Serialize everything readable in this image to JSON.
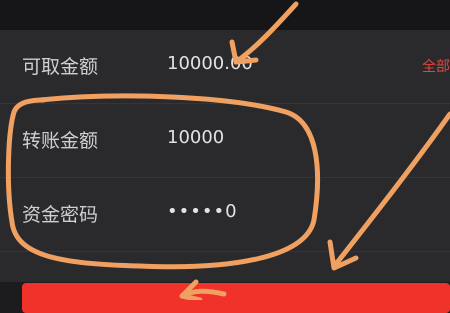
{
  "form": {
    "available_amount": {
      "label": "可取金额",
      "value": "10000.00",
      "action_label": "全部"
    },
    "transfer_amount": {
      "label": "转账金额",
      "value": "10000"
    },
    "fund_password": {
      "label": "资金密码",
      "masked_value": "•••••0"
    }
  },
  "colors": {
    "background": "#1c1c1e",
    "panel": "#2a2a2d",
    "accent_red": "#f0322b",
    "annotation_orange": "#f0a060"
  },
  "annotations": [
    "hand-drawn-arrow",
    "hand-drawn-circle"
  ]
}
